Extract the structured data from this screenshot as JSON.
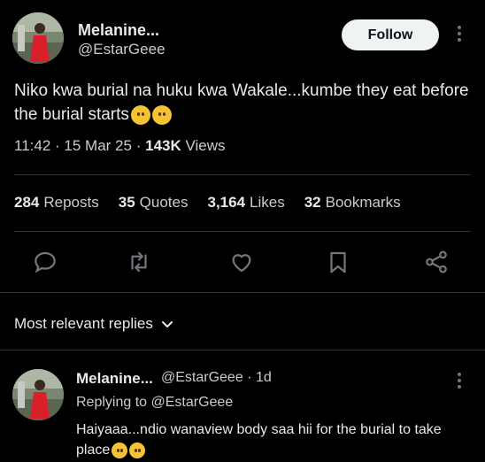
{
  "tweet": {
    "author_name": "Melanine...",
    "author_handle": "@EstarGeee",
    "follow_label": "Follow",
    "text": "Niko kwa burial na huku kwa Wakale...kumbe they eat before the burial starts",
    "emoji": "pleading-face",
    "time": "11:42",
    "date": "15 Mar 25",
    "views_count": "143K",
    "views_label": "Views",
    "sep": "·"
  },
  "stats": [
    {
      "count": "284",
      "label": "Reposts"
    },
    {
      "count": "35",
      "label": "Quotes"
    },
    {
      "count": "3,164",
      "label": "Likes"
    },
    {
      "count": "32",
      "label": "Bookmarks"
    }
  ],
  "actions": [
    "reply-icon",
    "repost-icon",
    "like-icon",
    "bookmark-icon",
    "share-icon"
  ],
  "replies": {
    "sort_label": "Most relevant replies",
    "items": [
      {
        "author_name": "Melanine...",
        "author_handle": "@EstarGeee",
        "age": "1d",
        "replying_prefix": "Replying to",
        "replying_handle": "@EstarGeee",
        "text": "Haiyaaa...ndio wanaview body saa hii for the burial to take place",
        "emoji": "relieved-face"
      }
    ]
  },
  "colors": {
    "background": "#000000",
    "text": "#e7e9ea",
    "secondary": "#71767b",
    "divider": "#2f3336",
    "follow_bg": "#eff3f4"
  }
}
